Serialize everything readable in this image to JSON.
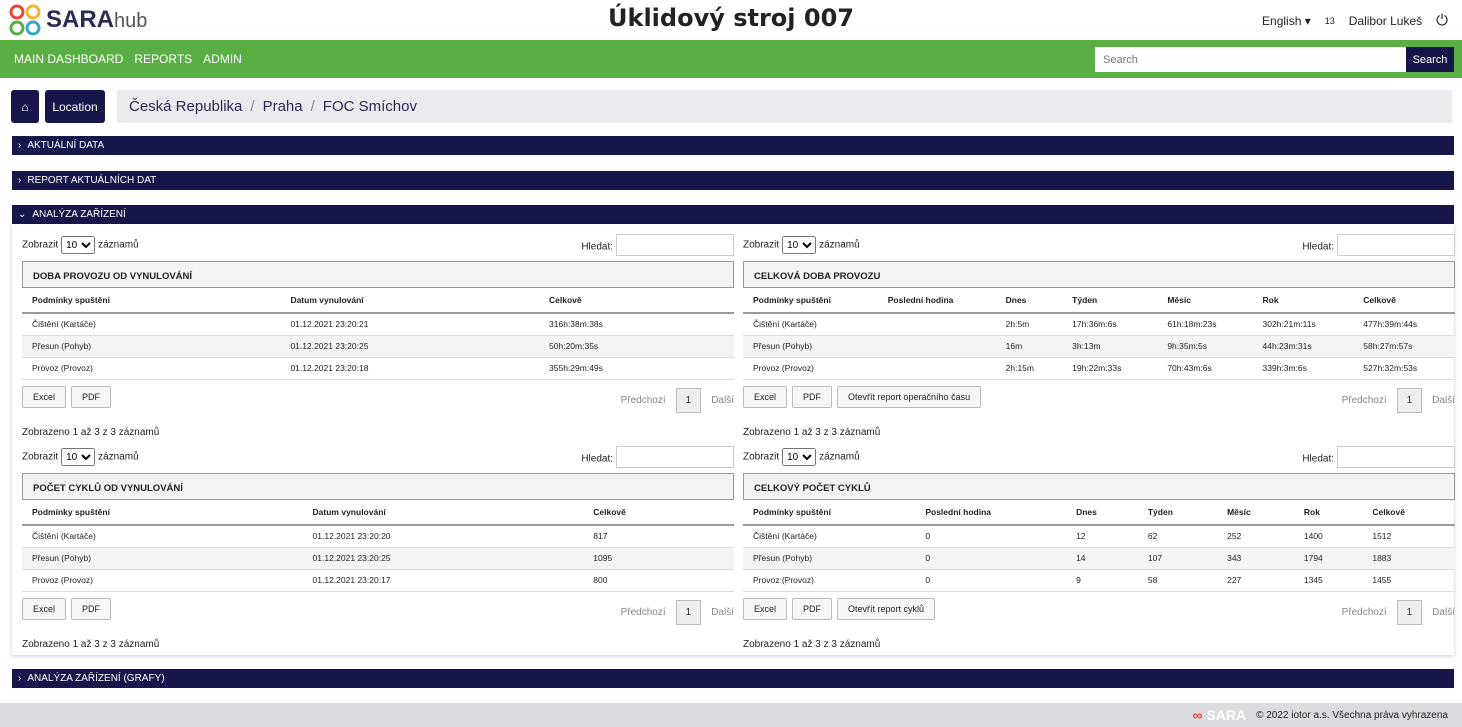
{
  "header": {
    "logo": "SARA",
    "logo_sub": "hub",
    "title": "Úklidový stroj 007",
    "language": "English",
    "count": "13",
    "user": "Dalibor Lukeš"
  },
  "nav": {
    "items": [
      "MAIN DASHBOARD",
      "REPORTS",
      "ADMIN"
    ],
    "search_placeholder": "Search",
    "search_button": "Search"
  },
  "breadcrumb": {
    "location_button": "Location",
    "items": [
      "Česká Republika",
      "Praha",
      "FOC Smíchov"
    ]
  },
  "sections": [
    "AKTUÁLNÍ DATA",
    "REPORT AKTUÁLNÍCH DAT",
    "ANALÝZA ZAŘÍZENÍ",
    "ANALÝZA ZAŘÍZENÍ (GRAFY)"
  ],
  "common": {
    "show": "Zobrazit",
    "entries": "záznamů",
    "page_size": "10",
    "search_label": "Hledat:",
    "excel": "Excel",
    "pdf": "PDF",
    "prev": "Předchozí",
    "page": "1",
    "next": "Další",
    "info": "Zobrazeno 1 až 3 z 3 záznamů"
  },
  "tables": [
    {
      "title": "DOBA PROVOZU OD VYNULOVÁNÍ",
      "columns": [
        "Podmínky spuštění",
        "Datum vynulování",
        "Celkově"
      ],
      "rows": [
        [
          "Čištění (Kartáče)",
          "01.12.2021 23:20:21",
          "316h:38m:38s"
        ],
        [
          "Přesun (Pohyb)",
          "01.12.2021 23:20:25",
          "50h:20m:35s"
        ],
        [
          "Provoz (Provoz)",
          "01.12.2021 23:20:18",
          "355h:29m:49s"
        ]
      ]
    },
    {
      "title": "CELKOVÁ DOBA PROVOZU",
      "extra_button": "Otevřít report operačního času",
      "columns": [
        "Podmínky spuštění",
        "Poslední hodina",
        "Dnes",
        "Týden",
        "Měsíc",
        "Rok",
        "Celkově"
      ],
      "rows": [
        [
          "Čištění (Kartáče)",
          "",
          "2h:5m",
          "17h:36m:6s",
          "61h:18m:23s",
          "302h:21m:11s",
          "477h:39m:44s"
        ],
        [
          "Přesun (Pohyb)",
          "",
          "16m",
          "3h:13m",
          "9h:35m:5s",
          "44h:23m:31s",
          "58h:27m:57s"
        ],
        [
          "Provoz (Provoz)",
          "",
          "2h:15m",
          "19h:22m:33s",
          "70h:43m:6s",
          "339h:3m:6s",
          "527h:32m:53s"
        ]
      ]
    },
    {
      "title": "POČET CYKLŮ OD VYNULOVÁNÍ",
      "columns": [
        "Podmínky spuštění",
        "Datum vynulování",
        "Celkově"
      ],
      "rows": [
        [
          "Čištění (Kartáče)",
          "01.12.2021 23:20:20",
          "817"
        ],
        [
          "Přesun (Pohyb)",
          "01.12.2021 23:20:25",
          "1095"
        ],
        [
          "Provoz (Provoz)",
          "01.12.2021 23:20:17",
          "800"
        ]
      ]
    },
    {
      "title": "CELKOVÝ POČET CYKLŮ",
      "extra_button": "Otevřít report cyklů",
      "columns": [
        "Podmínky spuštění",
        "Poslední hodina",
        "Dnes",
        "Týden",
        "Měsíc",
        "Rok",
        "Celkově"
      ],
      "rows": [
        [
          "Čištění (Kartáče)",
          "0",
          "12",
          "62",
          "252",
          "1400",
          "1512"
        ],
        [
          "Přesun (Pohyb)",
          "0",
          "14",
          "107",
          "343",
          "1794",
          "1883"
        ],
        [
          "Provoz (Provoz)",
          "0",
          "9",
          "58",
          "227",
          "1345",
          "1455"
        ]
      ]
    }
  ],
  "footer": {
    "text": "© 2022 iotor a.s. Všechna práva vyhrazena"
  },
  "colors": {
    "green": "#5aaf44",
    "navy": "#16164a"
  }
}
